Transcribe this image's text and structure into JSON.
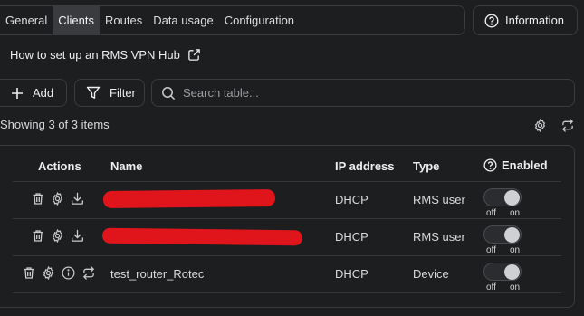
{
  "tabs": [
    {
      "label": "General",
      "active": false
    },
    {
      "label": "Clients",
      "active": true
    },
    {
      "label": "Routes",
      "active": false
    },
    {
      "label": "Data usage",
      "active": false
    },
    {
      "label": "Configuration",
      "active": false
    }
  ],
  "info_button": {
    "label": "Information",
    "icon": "question-circle-icon"
  },
  "howto_link": {
    "label": "How to set up an RMS VPN Hub",
    "icon": "external-link-icon"
  },
  "toolbar": {
    "add_label": "Add",
    "filter_label": "Filter",
    "search_placeholder": "Search table..."
  },
  "summary": {
    "showing": "Showing 3 of 3 items"
  },
  "table": {
    "headers": {
      "actions": "Actions",
      "name": "Name",
      "ip": "IP address",
      "type": "Type",
      "enabled": "Enabled"
    },
    "toggle_labels": {
      "off": "off",
      "on": "on"
    },
    "rows": [
      {
        "name": "",
        "name_redacted": true,
        "ip": "DHCP",
        "type": "RMS user",
        "enabled": true,
        "actions": [
          "trash-icon",
          "gear-icon",
          "download-icon"
        ]
      },
      {
        "name": "",
        "name_redacted": true,
        "ip": "DHCP",
        "type": "RMS user",
        "enabled": true,
        "actions": [
          "trash-icon",
          "gear-icon",
          "download-icon"
        ]
      },
      {
        "name": "test_router_Rotec",
        "name_redacted": false,
        "ip": "DHCP",
        "type": "Device",
        "enabled": true,
        "actions": [
          "trash-icon",
          "gear-icon",
          "info-icon",
          "repeat-icon"
        ]
      }
    ]
  },
  "colors": {
    "background": "#1d1e20",
    "border": "#3a3b3e",
    "redaction": "#e0141b"
  }
}
